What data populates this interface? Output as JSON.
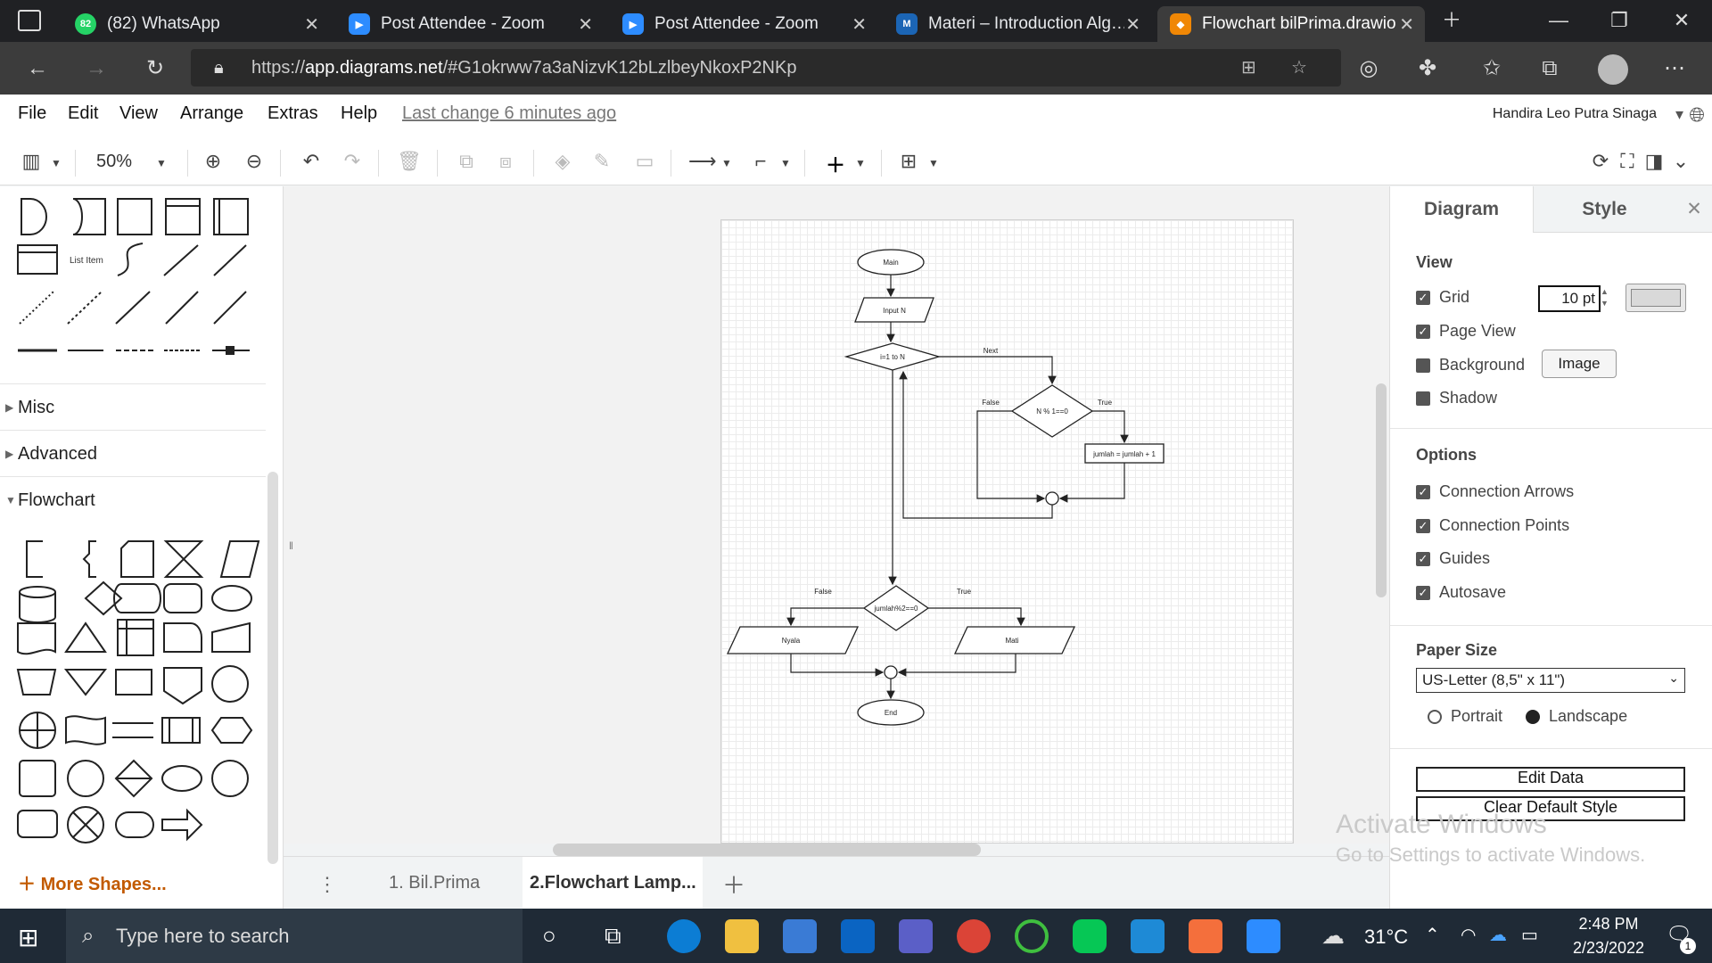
{
  "browser": {
    "tabs": [
      {
        "title": "(82) WhatsApp",
        "badge": "82",
        "color": "#25d366"
      },
      {
        "title": "Post Attendee - Zoom",
        "color": "#2d8cff"
      },
      {
        "title": "Post Attendee - Zoom",
        "color": "#2d8cff"
      },
      {
        "title": "Materi – Introduction Alg…",
        "color": "#1b65b5"
      },
      {
        "title": "Flowchart bilPrima.drawio",
        "color": "#f08705"
      }
    ],
    "url_prefix": "https://",
    "url_host": "app.diagrams.net",
    "url_rest": "/#G1okrww7a3aNizvK12bLzlbeyNkoxP2NKp"
  },
  "menu": {
    "items": [
      "File",
      "Edit",
      "View",
      "Arrange",
      "Extras",
      "Help"
    ],
    "last_change": "Last change 6 minutes ago",
    "user": "Handira Leo Putra Sinaga"
  },
  "toolbar": {
    "zoom": "50%"
  },
  "left_panel": {
    "list_item_label": "List Item",
    "sections": [
      "Misc",
      "Advanced",
      "Flowchart"
    ],
    "more_shapes": "More Shapes..."
  },
  "diagram": {
    "main": "Main",
    "input": "Input N",
    "loop": "i=1 to N",
    "next": "Next",
    "cond1": "N % 1==0",
    "false1": "False",
    "true1": "True",
    "process": "jumlah = jumlah + 1",
    "cond2": "jumlah%2==0",
    "false2": "False",
    "true2": "True",
    "out_false": "Nyala",
    "out_true": "Mati",
    "end": "End"
  },
  "page_tabs": [
    "1. Bil.Prima",
    "2.Flowchart Lamp..."
  ],
  "right_panel": {
    "tabs": [
      "Diagram",
      "Style"
    ],
    "view_title": "View",
    "view_options": [
      {
        "label": "Grid",
        "checked": true
      },
      {
        "label": "Page View",
        "checked": true
      },
      {
        "label": "Background",
        "checked": false
      },
      {
        "label": "Shadow",
        "checked": false
      }
    ],
    "grid_size": "10 pt",
    "image_button": "Image",
    "options_title": "Options",
    "options": [
      {
        "label": "Connection Arrows",
        "checked": true
      },
      {
        "label": "Connection Points",
        "checked": true
      },
      {
        "label": "Guides",
        "checked": true
      },
      {
        "label": "Autosave",
        "checked": true
      }
    ],
    "paper_title": "Paper Size",
    "paper_value": "US-Letter (8,5\" x 11\")",
    "orientation": [
      "Portrait",
      "Landscape"
    ],
    "orientation_selected": "Landscape",
    "edit_data": "Edit Data",
    "clear_style": "Clear Default Style"
  },
  "watermark": {
    "line1": "Activate Windows",
    "line2": "Go to Settings to activate Windows."
  },
  "taskbar": {
    "search_placeholder": "Type here to search",
    "temperature": "31°C",
    "time": "2:48 PM",
    "date": "2/23/2022",
    "notifications": "1"
  }
}
